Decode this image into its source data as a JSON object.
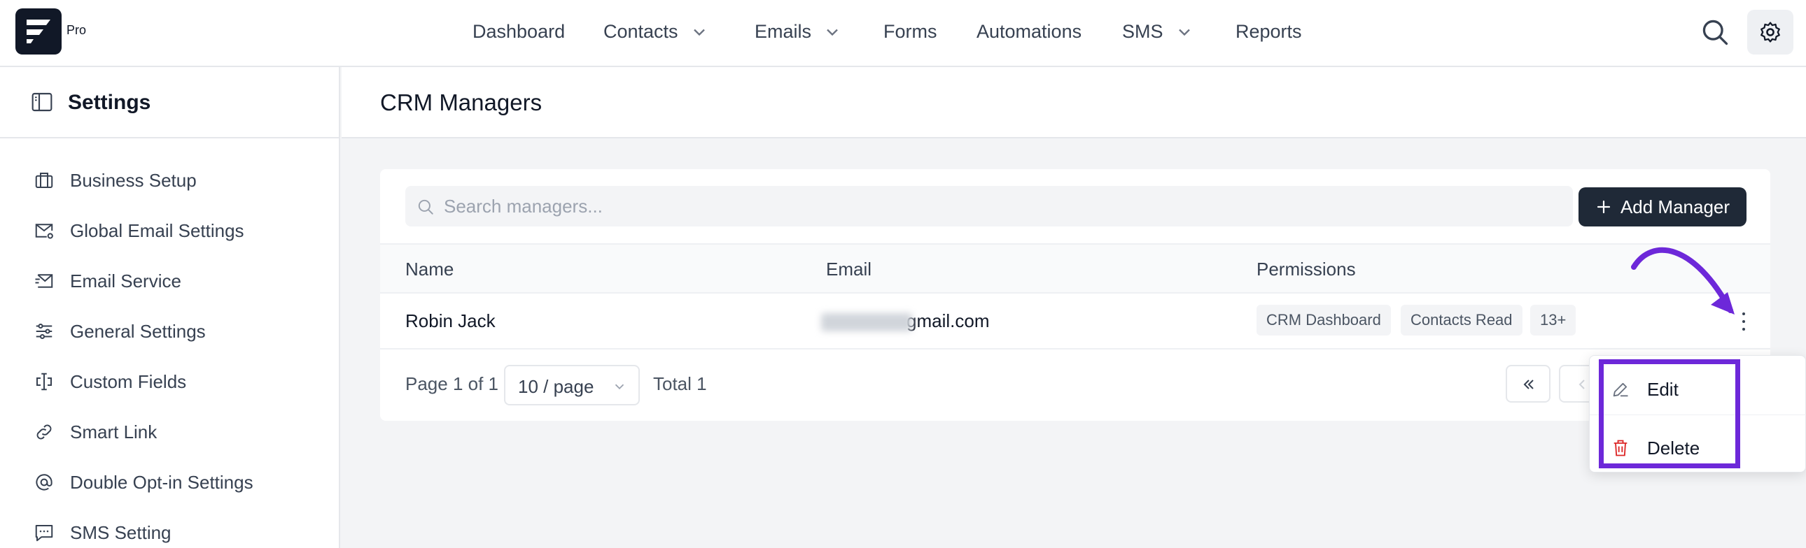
{
  "app": {
    "badge": "Pro"
  },
  "nav": {
    "items": [
      {
        "label": "Dashboard",
        "has_dropdown": false
      },
      {
        "label": "Contacts",
        "has_dropdown": true
      },
      {
        "label": "Emails",
        "has_dropdown": true
      },
      {
        "label": "Forms",
        "has_dropdown": false
      },
      {
        "label": "Automations",
        "has_dropdown": false
      },
      {
        "label": "SMS",
        "has_dropdown": true
      },
      {
        "label": "Reports",
        "has_dropdown": false
      }
    ],
    "search_icon": "search-icon",
    "settings_icon": "gear-icon"
  },
  "sidebar": {
    "title": "Settings",
    "items": [
      {
        "label": "Business Setup",
        "icon": "briefcase-icon"
      },
      {
        "label": "Global Email Settings",
        "icon": "mail-settings-icon"
      },
      {
        "label": "Email Service",
        "icon": "mail-send-icon"
      },
      {
        "label": "General Settings",
        "icon": "sliders-icon"
      },
      {
        "label": "Custom Fields",
        "icon": "custom-fields-icon"
      },
      {
        "label": "Smart Link",
        "icon": "link-icon"
      },
      {
        "label": "Double Opt-in Settings",
        "icon": "at-sign-icon"
      },
      {
        "label": "SMS Setting",
        "icon": "message-icon"
      }
    ]
  },
  "main": {
    "title": "CRM Managers",
    "search": {
      "placeholder": "Search managers..."
    },
    "add_button": "Add Manager",
    "table": {
      "columns": [
        "Name",
        "Email",
        "Permissions"
      ],
      "rows": [
        {
          "name": "Robin Jack",
          "email_visible": "gmail.com",
          "permissions": [
            "CRM Dashboard",
            "Contacts Read",
            "13+"
          ]
        }
      ]
    },
    "pagination": {
      "page_text": "Page 1 of 1",
      "per_page": "10 / page",
      "total_text": "Total 1"
    }
  },
  "row_menu": {
    "items": [
      {
        "label": "Edit",
        "icon": "pencil-icon"
      },
      {
        "label": "Delete",
        "icon": "trash-icon"
      }
    ]
  },
  "colors": {
    "annotation": "#6d28d9",
    "delete_icon": "#dc2626",
    "primary_button": "#1f2937"
  }
}
